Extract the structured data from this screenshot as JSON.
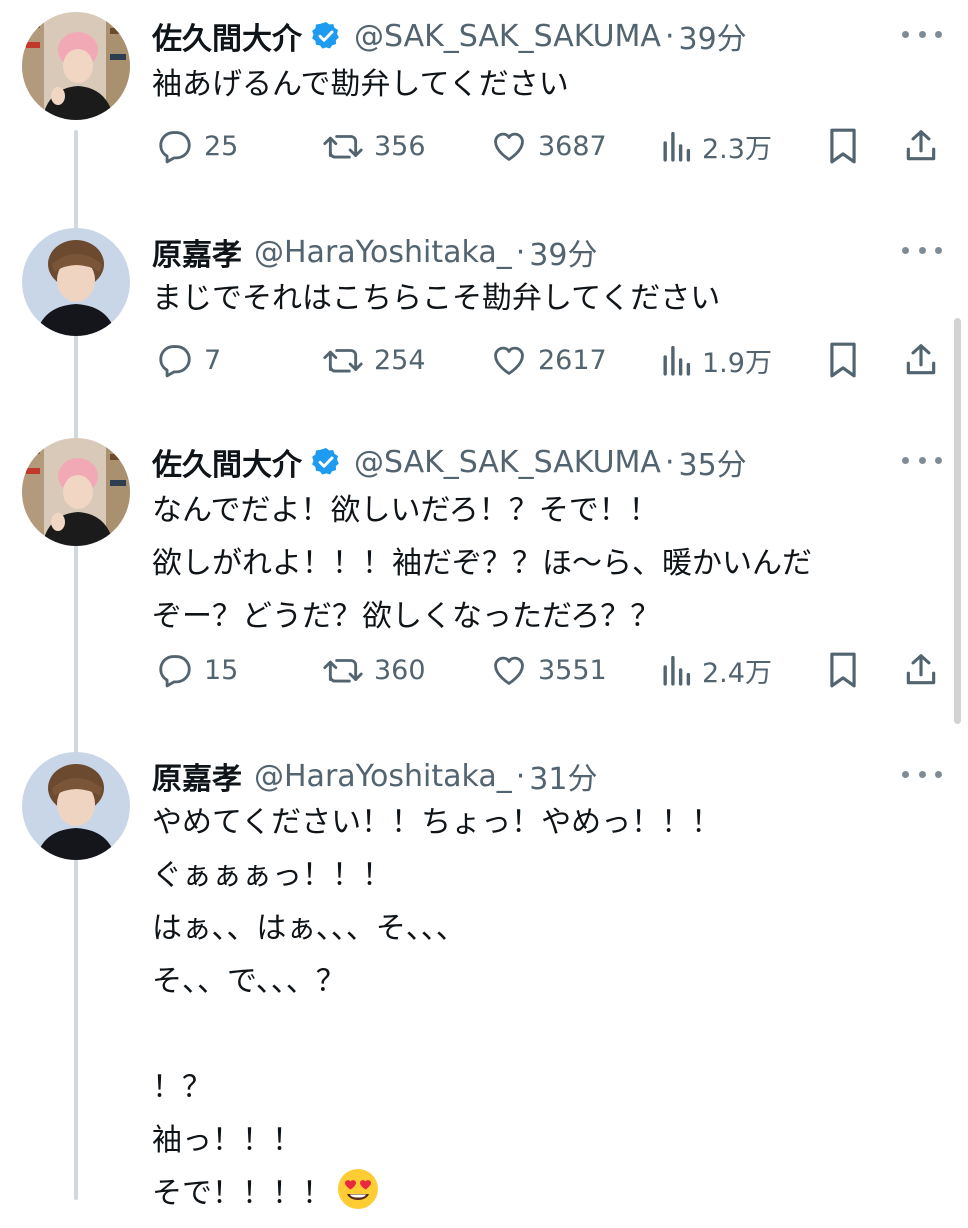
{
  "tweets": [
    {
      "name": "佐久間大介",
      "verified": true,
      "handle": "@SAK_SAK_SAKUMA",
      "time": "39分",
      "text": "袖あげるんで勘弁してください",
      "replies": "25",
      "retweets": "356",
      "likes": "3687",
      "views": "2.3万"
    },
    {
      "name": "原嘉孝",
      "verified": false,
      "handle": "@HaraYoshitaka_",
      "time": "39分",
      "text": "まじでそれはこちらこそ勘弁してください",
      "replies": "7",
      "retweets": "254",
      "likes": "2617",
      "views": "1.9万"
    },
    {
      "name": "佐久間大介",
      "verified": true,
      "handle": "@SAK_SAK_SAKUMA",
      "time": "35分",
      "text": "なんでだよ！欲しいだろ！？そで！！\n欲しがれよ！！！袖だぞ？？ほ〜ら、暖かいんだ\nぞー？どうだ？欲しくなっただろ？？",
      "replies": "15",
      "retweets": "360",
      "likes": "3551",
      "views": "2.4万"
    },
    {
      "name": "原嘉孝",
      "verified": false,
      "handle": "@HaraYoshitaka_",
      "time": "31分",
      "text": "やめてください！！ちょっ！やめっ！！！\nぐぁぁぁっ！！！\nはぁ、、はぁ、、、そ、、、\nそ、、で、、、？\n\n！？\n袖っ！！！\nそで！！！！",
      "emoji": "heart-eyes-emoji"
    }
  ],
  "colors": {
    "text": "#0f1419",
    "muted": "#536471",
    "verified_blue": "#1d9bf0",
    "thread_line": "#cfd9de"
  }
}
